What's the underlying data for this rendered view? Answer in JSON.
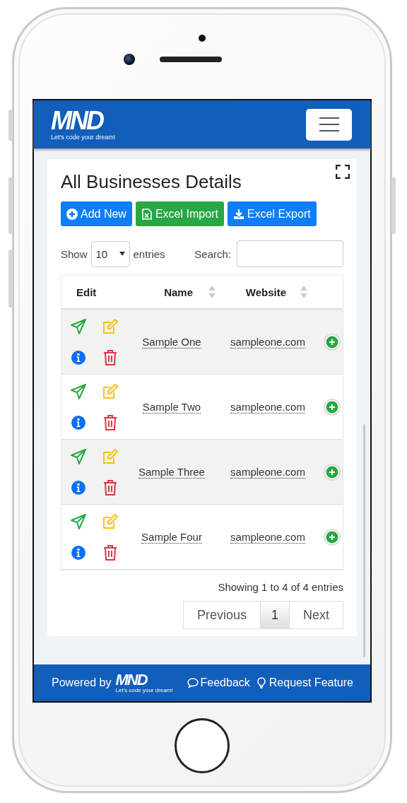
{
  "header": {
    "logo": "MND",
    "tagline": "Let's code your dream!"
  },
  "card": {
    "title": "All Businesses Details",
    "actions": [
      {
        "label": "Add New",
        "kind": "add"
      },
      {
        "label": "Excel Import",
        "kind": "import"
      },
      {
        "label": "Excel Export",
        "kind": "export"
      }
    ],
    "length": {
      "prefix": "Show",
      "value": "10",
      "suffix": "entries"
    },
    "search": {
      "label": "Search:"
    },
    "table": {
      "columns": [
        {
          "label": "Edit",
          "sortable": false
        },
        {
          "label": "Name",
          "sortable": true
        },
        {
          "label": "Website",
          "sortable": true
        }
      ],
      "rows": [
        {
          "name": "Sample One",
          "website": "sampleone.com"
        },
        {
          "name": "Sample Two",
          "website": "sampleone.com"
        },
        {
          "name": "Sample Three",
          "website": "sampleone.com"
        },
        {
          "name": "Sample Four",
          "website": "sampleone.com"
        }
      ]
    },
    "info": "Showing 1 to 4 of 4 entries",
    "pagination": [
      {
        "label": "Previous",
        "selected": false
      },
      {
        "label": "1",
        "selected": true
      },
      {
        "label": "Next",
        "selected": false
      }
    ]
  },
  "footer": {
    "powered_by": "Powered by",
    "logo": "MND",
    "tagline": "Let's code your dream!",
    "links": [
      {
        "label": "Feedback",
        "kind": "feedback"
      },
      {
        "label": "Request Feature",
        "kind": "idea"
      }
    ]
  }
}
